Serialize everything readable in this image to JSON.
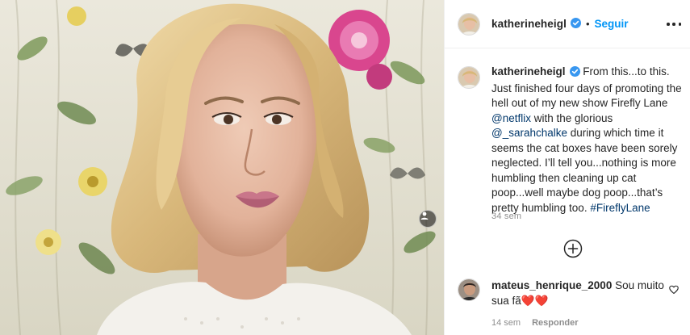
{
  "post": {
    "author": "katherineheigl",
    "follow_label": "Seguir",
    "separator": "•",
    "caption": {
      "author": "katherineheigl",
      "text_1": "From this...to this. Just finished four days of promoting the hell out of my new show Firefly Lane ",
      "mention_1": "@netflix",
      "text_2": " with the glorious ",
      "mention_2": "@_sarahchalke",
      "text_3": " during which time it seems the cat boxes have been sorely neglected. I’ll tell you...nothing is more humbling then cleaning up cat poop...well maybe dog poop...that’s pretty humbling too. ",
      "hashtag": "#FireflyLane",
      "time": "34 sem"
    }
  },
  "comments": [
    {
      "author": "mateus_henrique_2000",
      "text": "Sou muito sua fã",
      "emoji": "❤️❤️",
      "time": "14 sem",
      "reply_label": "Responder"
    }
  ],
  "icons": {
    "more": "more-options-icon",
    "verified": "verified-badge-icon",
    "load_more": "plus-circle-icon",
    "like": "heart-outline-icon",
    "tag": "tag-person-icon"
  },
  "colors": {
    "link": "#00376b",
    "follow": "#0095f6",
    "verified": "#3897f0",
    "muted": "#8e8e8e"
  }
}
